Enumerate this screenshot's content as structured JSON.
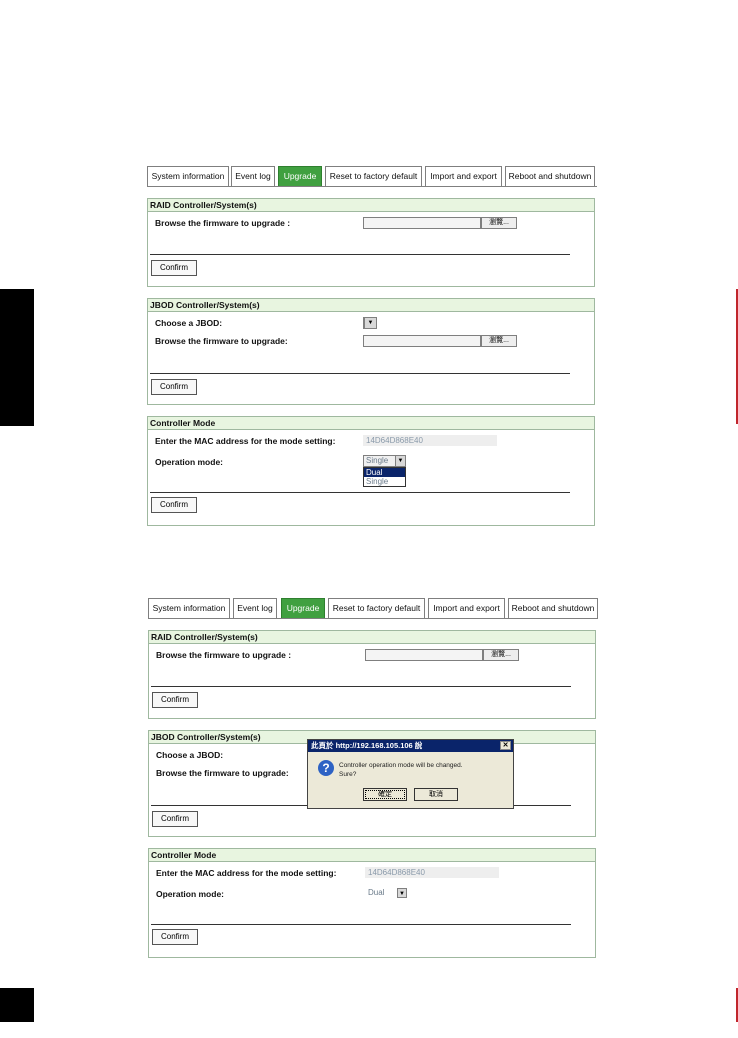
{
  "tabs": [
    "System information",
    "Event log",
    "Upgrade",
    "Reset to factory default",
    "Import and export",
    "Reboot and shutdown"
  ],
  "active_tab": "Upgrade",
  "raid": {
    "title": "RAID Controller/System(s)",
    "browse_label": "Browse the firmware to upgrade :",
    "browse_button": "瀏覽...",
    "confirm": "Confirm"
  },
  "jbod": {
    "title": "JBOD Controller/System(s)",
    "choose_label": "Choose a JBOD:",
    "browse_label": "Browse the firmware to upgrade:",
    "browse_button": "瀏覽...",
    "confirm": "Confirm"
  },
  "controller_mode": {
    "title": "Controller Mode",
    "mac_label": "Enter the MAC address for the mode setting:",
    "mac_value": "14D64D868E40",
    "mode_label": "Operation mode:",
    "confirm": "Confirm"
  },
  "screen1": {
    "mode_selected": "Single",
    "dropdown_options": [
      "Dual",
      "Single"
    ],
    "highlighted_option": "Dual"
  },
  "screen2": {
    "mode_selected": "Dual"
  },
  "dialog": {
    "title": "此頁於 http://192.168.105.106 說",
    "message_line1": "Controller operation mode will be changed.",
    "message_line2": "Sure?",
    "ok_label": "確定",
    "cancel_label": "取消"
  },
  "colors": {
    "active_tab": "#40a040",
    "panel_header": "#e8f5e0",
    "dialog_title": "#0a246a",
    "page_edge_accent": "#c0262c"
  }
}
